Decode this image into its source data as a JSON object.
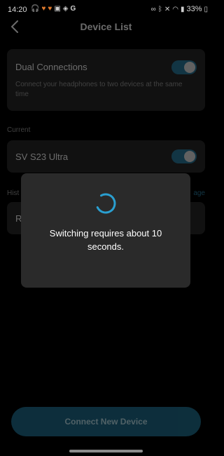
{
  "status_bar": {
    "time": "14:20",
    "battery": "33%",
    "left_icons": [
      "headphones-icon",
      "heart-icon",
      "heart-icon",
      "image-icon",
      "shield-icon",
      "google-icon"
    ],
    "right_icons": [
      "link-icon",
      "bluetooth-icon",
      "mute-icon",
      "wifi-icon",
      "signal-icon",
      "battery-icon"
    ]
  },
  "header": {
    "title": "Device List"
  },
  "dual": {
    "label": "Dual Connections",
    "description": "Connect your headphones to two devices at the same time",
    "enabled": true
  },
  "current": {
    "section_label": "Current",
    "device": "SV S23 Ultra",
    "enabled": true
  },
  "history": {
    "section_label": "Hist",
    "manage_label": "age",
    "device_initial": "R"
  },
  "connect_button": {
    "label": "Connect New Device"
  },
  "modal": {
    "message": "Switching requires about 10 seconds."
  },
  "colors": {
    "accent": "#2b7fa3",
    "card": "#2a2a2a",
    "background": "#000000"
  }
}
